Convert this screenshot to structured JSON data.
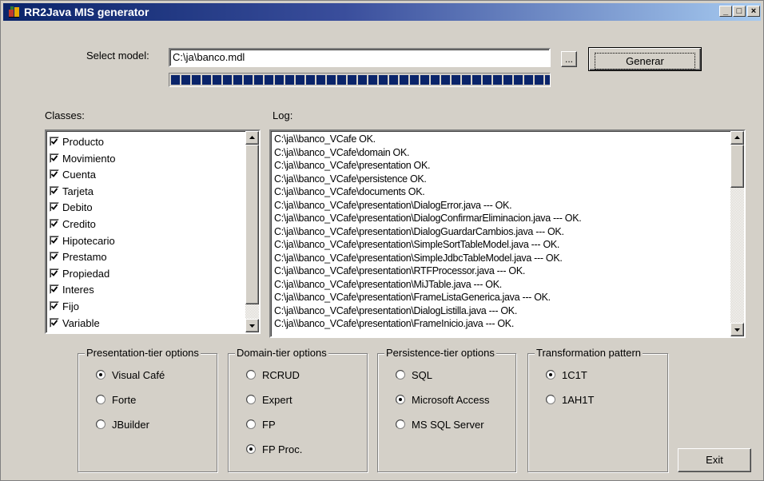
{
  "window": {
    "title": "RR2Java MIS generator",
    "min": "_",
    "max": "□",
    "close": "×"
  },
  "model": {
    "label": "Select model:",
    "value": "C:\\ja\\banco.mdl",
    "browse_label": "...",
    "generate_label": "Generar",
    "progress": 1.0
  },
  "classes": {
    "label": "Classes:",
    "items": [
      {
        "name": "Producto",
        "checked": true
      },
      {
        "name": "Movimiento",
        "checked": true
      },
      {
        "name": "Cuenta",
        "checked": true
      },
      {
        "name": "Tarjeta",
        "checked": true
      },
      {
        "name": "Debito",
        "checked": true
      },
      {
        "name": "Credito",
        "checked": true
      },
      {
        "name": "Hipotecario",
        "checked": true
      },
      {
        "name": "Prestamo",
        "checked": true
      },
      {
        "name": "Propiedad",
        "checked": true
      },
      {
        "name": "Interes",
        "checked": true
      },
      {
        "name": "Fijo",
        "checked": true
      },
      {
        "name": "Variable",
        "checked": true
      }
    ]
  },
  "log": {
    "label": "Log:",
    "lines": [
      "C:\\ja\\\\banco_VCafe OK.",
      "C:\\ja\\\\banco_VCafe\\domain OK.",
      "C:\\ja\\\\banco_VCafe\\presentation OK.",
      "C:\\ja\\\\banco_VCafe\\persistence OK.",
      "C:\\ja\\\\banco_VCafe\\documents OK.",
      "C:\\ja\\\\banco_VCafe\\presentation\\DialogError.java --- OK.",
      "C:\\ja\\\\banco_VCafe\\presentation\\DialogConfirmarEliminacion.java --- OK.",
      "C:\\ja\\\\banco_VCafe\\presentation\\DialogGuardarCambios.java --- OK.",
      "C:\\ja\\\\banco_VCafe\\presentation\\SimpleSortTableModel.java --- OK.",
      "C:\\ja\\\\banco_VCafe\\presentation\\SimpleJdbcTableModel.java --- OK.",
      "C:\\ja\\\\banco_VCafe\\presentation\\RTFProcessor.java --- OK.",
      "C:\\ja\\\\banco_VCafe\\presentation\\MiJTable.java --- OK.",
      "C:\\ja\\\\banco_VCafe\\presentation\\FrameListaGenerica.java --- OK.",
      "C:\\ja\\\\banco_VCafe\\presentation\\DialogListilla.java --- OK.",
      "C:\\ja\\\\banco_VCafe\\presentation\\FrameInicio.java --- OK."
    ]
  },
  "options": {
    "presentation": {
      "title": "Presentation-tier options",
      "items": [
        "Visual Café",
        "Forte",
        "JBuilder"
      ],
      "selected": "Visual Café"
    },
    "domain": {
      "title": "Domain-tier options",
      "items": [
        "RCRUD",
        "Expert",
        "FP",
        "FP Proc."
      ],
      "selected": "FP Proc."
    },
    "persistence": {
      "title": "Persistence-tier options",
      "items": [
        "SQL",
        "Microsoft Access",
        "MS SQL Server"
      ],
      "selected": "Microsoft Access"
    },
    "pattern": {
      "title": "Transformation pattern",
      "items": [
        "1C1T",
        "1AH1T"
      ],
      "selected": "1C1T"
    }
  },
  "exit_label": "Exit"
}
